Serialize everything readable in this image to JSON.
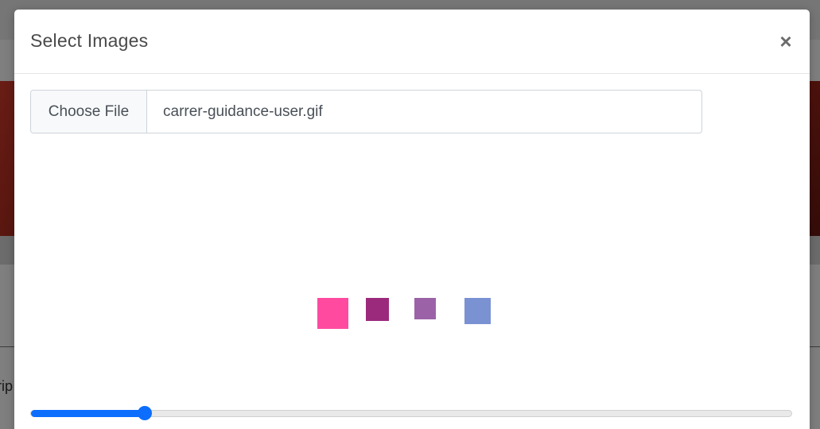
{
  "modal": {
    "title": "Select Images",
    "close_symbol": "×",
    "close_icon": "close-icon"
  },
  "file_input": {
    "button_label": "Choose File",
    "file_name": "carrer-guidance-user.gif"
  },
  "loader": {
    "colors": [
      "#ff4aa0",
      "#9b2a7c",
      "#9c62a8",
      "#7a92d2"
    ]
  },
  "slider": {
    "value": 0.15,
    "accent": "#0d6efd"
  },
  "background_page": {
    "partial_text": "rip"
  }
}
